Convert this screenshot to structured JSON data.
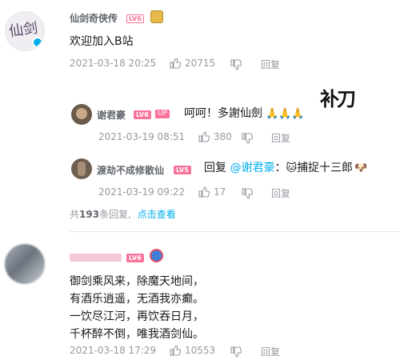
{
  "comment1": {
    "avatar_text": "仙剑",
    "user": "仙剑奇侠传",
    "level": "LV6",
    "text": "欢迎加入B站",
    "time": "2021-03-18 20:25",
    "likes": "20715",
    "reply": "回复",
    "replies": [
      {
        "user": "谢君豪",
        "level": "LV6",
        "badge": "UP",
        "text": "呵呵！多謝仙劍",
        "emoji": "🙏🙏🙏",
        "sticker": "补刀",
        "time": "2021-03-19 08:51",
        "likes": "380",
        "reply": "回复"
      },
      {
        "user": "渡劫不成修散仙",
        "level": "LV5",
        "reply_prefix": "回复",
        "mention": "@谢君豪",
        "colon": "：",
        "emoji1": "🐱",
        "text": "捕捉十三郎",
        "emoji2": "🐶",
        "time": "2021-03-19 09:22",
        "likes": "17",
        "reply": "回复"
      }
    ],
    "summary_prefix": "共",
    "summary_count": "193",
    "summary_suffix": "条回复,",
    "summary_link": "点击查看"
  },
  "comment2": {
    "level": "LV6",
    "lines": [
      "御剑乘风来，除魔天地间，",
      "有酒乐逍遥，无酒我亦癫。",
      "一饮尽江河，再饮吞日月，",
      "千杯醉不倒，唯我酒剑仙。"
    ],
    "time": "2021-03-18 17:29",
    "likes": "10553",
    "reply": "回复"
  },
  "colors": {
    "accent": "#fb7299",
    "link": "#00aeec",
    "meta": "#9499a0"
  }
}
